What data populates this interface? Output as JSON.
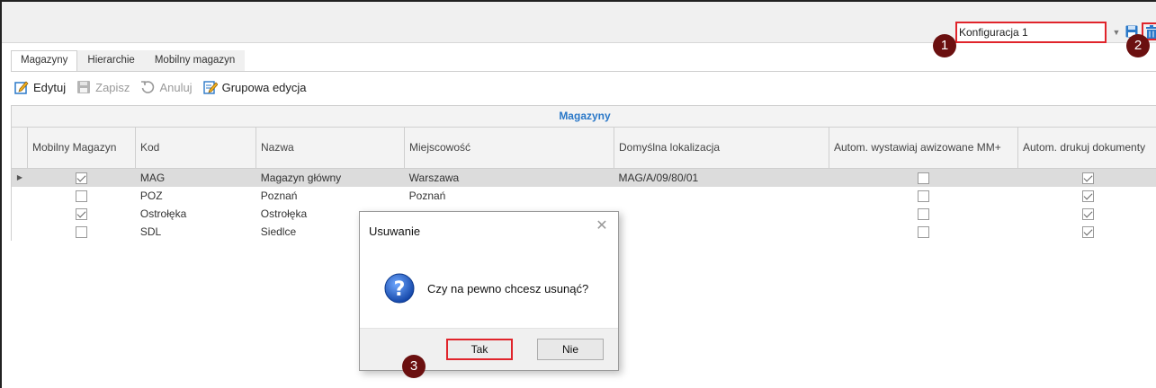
{
  "config": {
    "selected": "Konfiguracja 1"
  },
  "markers": [
    "1",
    "2",
    "3"
  ],
  "tabs": [
    "Magazyny",
    "Hierarchie",
    "Mobilny magazyn"
  ],
  "toolbar": {
    "edit": "Edytuj",
    "save": "Zapisz",
    "cancel": "Anuluj",
    "group_edit": "Grupowa edycja"
  },
  "grid": {
    "title": "Magazyny",
    "columns": [
      "Mobilny Magazyn",
      "Kod",
      "Nazwa",
      "Miejscowość",
      "Domyślna lokalizacja",
      "Autom. wystawiaj awizowane MM+",
      "Autom. drukuj dokumenty"
    ],
    "rows": [
      {
        "mobile": true,
        "code": "MAG",
        "name": "Magazyn główny",
        "city": "Warszawa",
        "location": "MAG/A/09/80/01",
        "auto_issue": false,
        "auto_print": true
      },
      {
        "mobile": false,
        "code": "POZ",
        "name": "Poznań",
        "city": "Poznań",
        "location": "",
        "auto_issue": false,
        "auto_print": true
      },
      {
        "mobile": true,
        "code": "Ostrołęka",
        "name": "Ostrołęka",
        "city": "",
        "location": "",
        "auto_issue": false,
        "auto_print": true
      },
      {
        "mobile": false,
        "code": "SDL",
        "name": "Siedlce",
        "city": "",
        "location": "",
        "auto_issue": false,
        "auto_print": true
      }
    ]
  },
  "dialog": {
    "title": "Usuwanie",
    "message": "Czy na pewno chcesz usunąć?",
    "yes": "Tak",
    "no": "Nie"
  },
  "colors": {
    "highlight": "#e0242b",
    "marker": "#6b1010",
    "title_blue": "#2a78c8"
  }
}
